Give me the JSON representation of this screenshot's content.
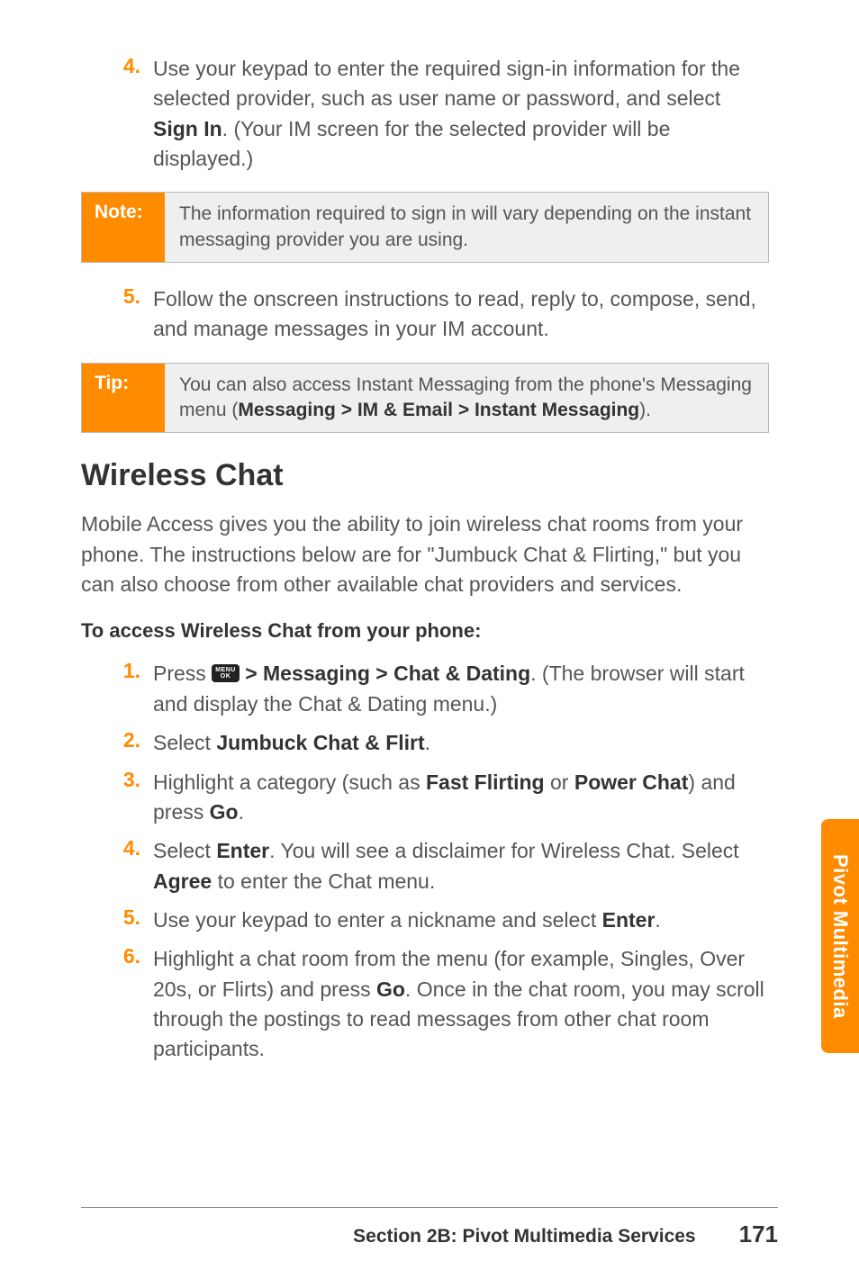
{
  "topList": {
    "item4": {
      "num": "4.",
      "text_a": "Use your keypad to enter the required sign-in information for the selected provider, such as user name or password, and select ",
      "bold_a": "Sign In",
      "text_b": ". (Your IM screen for the selected provider will be displayed.)"
    },
    "item5": {
      "num": "5.",
      "text": "Follow the onscreen instructions to read, reply to, compose, send, and manage messages in your IM account."
    }
  },
  "note": {
    "label": "Note:",
    "text": "The information required to sign in will vary depending on the instant messaging provider you are using."
  },
  "tip": {
    "label": "Tip:",
    "text_a": "You can also access Instant Messaging from the phone's Messaging menu (",
    "bold_a": "Messaging > IM & Email > Instant Messaging",
    "text_b": ")."
  },
  "heading": "Wireless Chat",
  "para": "Mobile Access gives you the ability to join wireless chat rooms from your phone. The instructions below are for \"Jumbuck Chat & Flirting,\" but you can also choose from other available chat providers and services.",
  "subheading": "To access Wireless Chat from your phone:",
  "menuIcon": {
    "top": "MENU",
    "bottom": "OK"
  },
  "steps": {
    "s1": {
      "num": "1.",
      "pre": "Press ",
      "bold_a": " > Messaging > Chat & Dating",
      "post": ". (The browser will start and display the Chat & Dating menu.)"
    },
    "s2": {
      "num": "2.",
      "pre": "Select ",
      "bold_a": "Jumbuck Chat & Flirt",
      "post": "."
    },
    "s3": {
      "num": "3.",
      "pre": "Highlight a category (such as ",
      "bold_a": "Fast Flirting",
      "mid": " or ",
      "bold_b": "Power Chat",
      "mid2": ") and press ",
      "bold_c": "Go",
      "post": "."
    },
    "s4": {
      "num": "4.",
      "pre": "Select ",
      "bold_a": "Enter",
      "mid": ". You will see a disclaimer for Wireless Chat. Select ",
      "bold_b": "Agree",
      "post": " to enter the Chat menu."
    },
    "s5": {
      "num": "5.",
      "pre": "Use your keypad to enter a nickname and select ",
      "bold_a": "Enter",
      "post": "."
    },
    "s6": {
      "num": "6.",
      "pre": "Highlight a chat room from the menu (for example, Singles, Over 20s, or Flirts) and press ",
      "bold_a": "Go",
      "post": ". Once in the chat room, you may scroll through the postings to read messages from other chat room participants."
    }
  },
  "sideTab": "Pivot Multimedia",
  "footer": {
    "title": "Section 2B: Pivot Multimedia Services",
    "page": "171"
  }
}
